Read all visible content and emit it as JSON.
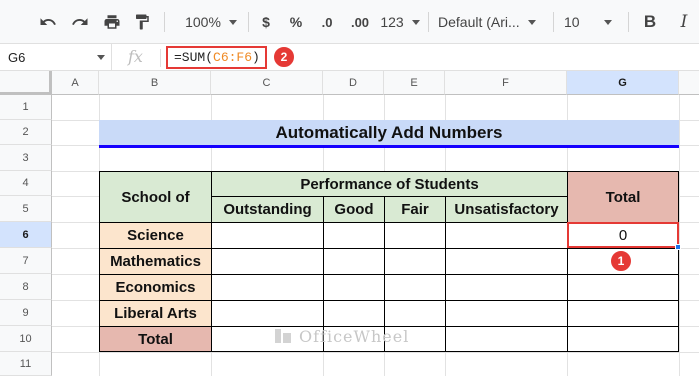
{
  "toolbar": {
    "zoom": "100%",
    "currency": "$",
    "percent": "%",
    "decimal_decrease": ".0",
    "decimal_increase": ".00",
    "number_format": "123",
    "font_family": "Default (Ari...",
    "font_size": "10",
    "bold": "B",
    "italic": "I"
  },
  "formula_bar": {
    "cell_ref": "G6",
    "fx_label": "fx",
    "formula_prefix": "=SUM(",
    "formula_range": "C6:F6",
    "formula_suffix": ")"
  },
  "annotations": {
    "badge_1": "1",
    "badge_2": "2"
  },
  "columns": [
    "A",
    "B",
    "C",
    "D",
    "E",
    "F",
    "G"
  ],
  "rows": [
    "1",
    "2",
    "3",
    "4",
    "5",
    "6",
    "7",
    "8",
    "9",
    "10",
    "11"
  ],
  "sheet": {
    "title": "Automatically Add Numbers",
    "school_header": "School of",
    "performance_header": "Performance of Students",
    "total_header": "Total",
    "categories": [
      "Outstanding",
      "Good",
      "Fair",
      "Unsatisfactory"
    ],
    "subjects": [
      "Science",
      "Mathematics",
      "Economics",
      "Liberal Arts"
    ],
    "total_row_label": "Total",
    "g6_value": "0"
  },
  "watermark": {
    "text": "OfficeWheel"
  },
  "colors": {
    "title_bg": "#c9daf8",
    "header_green": "#d9ead3",
    "subject_peach": "#fce5cd",
    "total_rose": "#e6b8af",
    "highlight_red": "#e53935"
  }
}
